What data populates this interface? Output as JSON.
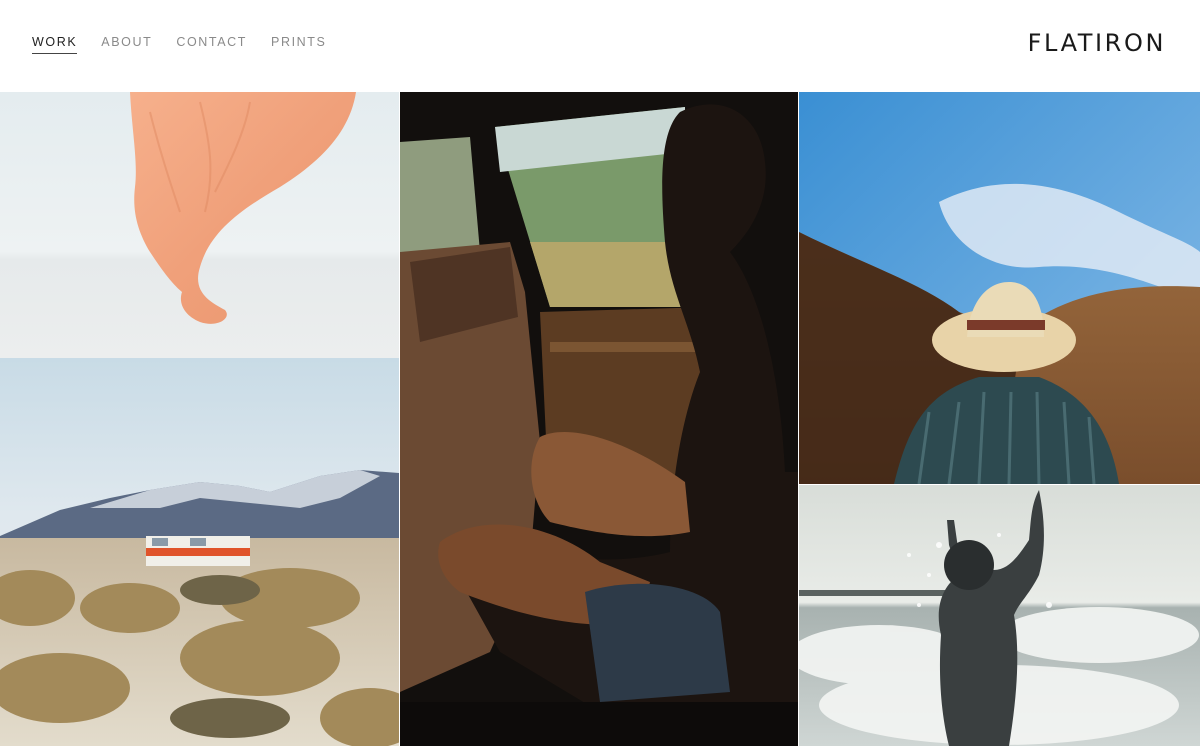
{
  "header": {
    "nav": [
      {
        "label": "WORK",
        "active": true
      },
      {
        "label": "ABOUT",
        "active": false
      },
      {
        "label": "CONTACT",
        "active": false
      },
      {
        "label": "PRINTS",
        "active": false
      }
    ],
    "logo": "FLATIRON"
  },
  "gallery": {
    "photos": [
      {
        "name": "photo-peach-fabric",
        "subject": "peach fabric floating over white salt flat"
      },
      {
        "name": "photo-desert-trailer",
        "subject": "trailer in desert with snowy mountains"
      },
      {
        "name": "photo-woman-in-car",
        "subject": "woman sitting in car interior"
      },
      {
        "name": "photo-man-straw-hat",
        "subject": "man in straw hat facing brown hills under blue sky"
      },
      {
        "name": "photo-woman-splashing-ocean",
        "subject": "woman splashing in ocean waves, black and white"
      }
    ]
  },
  "colors": {
    "nav_active": "#222222",
    "nav_inactive": "#8a8a8a",
    "logo": "#1a1a1a",
    "background": "#ffffff"
  }
}
